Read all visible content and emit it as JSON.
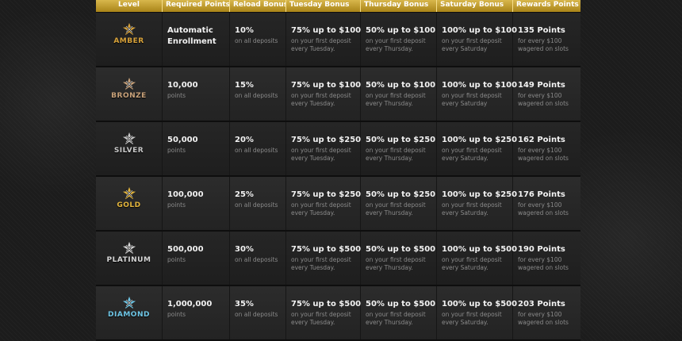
{
  "headers": [
    "Level",
    "Required Points",
    "Reload Bonus",
    "Tuesday Bonus",
    "Thursday Bonus",
    "Saturday Bonus",
    "Rewards Points"
  ],
  "rows": [
    {
      "level": "AMBER",
      "level_color": "#d9a33a",
      "required": "Automatic Enrollment",
      "required_sub": "",
      "reload": "10%",
      "reload_sub": "on all deposits",
      "tuesday": "75% up to $100",
      "tuesday_sub1": "on your first deposit",
      "tuesday_sub2": "every Tuesday.",
      "thursday": "50% up to $100",
      "thursday_sub1": "on your first deposit",
      "thursday_sub2": "every Thursday.",
      "saturday": "100% up to $100",
      "saturday_sub1": "on your first deposit",
      "saturday_sub2": "every Saturday",
      "rewards": "135 Points",
      "rewards_sub1": "for every $100",
      "rewards_sub2": "wagered on slots"
    },
    {
      "level": "BRONZE",
      "level_color": "#c9a27a",
      "required": "10,000",
      "required_sub": "points",
      "reload": "15%",
      "reload_sub": "on all deposits",
      "tuesday": "75% up to $100",
      "tuesday_sub1": "on your first deposit",
      "tuesday_sub2": "every Tuesday.",
      "thursday": "50% up to $100",
      "thursday_sub1": "on your first deposit",
      "thursday_sub2": "every Thursday.",
      "saturday": "100% up to $100",
      "saturday_sub1": "on your first deposit",
      "saturday_sub2": "every Saturday",
      "rewards": "149 Points",
      "rewards_sub1": "for every $100",
      "rewards_sub2": "wagered on slots"
    },
    {
      "level": "SILVER",
      "level_color": "#c8c8c8",
      "required": "50,000",
      "required_sub": "points",
      "reload": "20%",
      "reload_sub": "on all deposits",
      "tuesday": "75% up to $250",
      "tuesday_sub1": "on your first deposit",
      "tuesday_sub2": "every Tuesday.",
      "thursday": "50% up to $250",
      "thursday_sub1": "on your first deposit",
      "thursday_sub2": "every Thursday.",
      "saturday": "100% up to $250",
      "saturday_sub1": "on your first deposit",
      "saturday_sub2": "every Saturday.",
      "rewards": "162 Points",
      "rewards_sub1": "for every $100",
      "rewards_sub2": "wagered on slots"
    },
    {
      "level": "GOLD",
      "level_color": "#e2b43c",
      "required": "100,000",
      "required_sub": "points",
      "reload": "25%",
      "reload_sub": "on all deposits",
      "tuesday": "75% up to $250",
      "tuesday_sub1": "on your first deposit",
      "tuesday_sub2": "every Tuesday.",
      "thursday": "50% up to $250",
      "thursday_sub1": "on your first deposit",
      "thursday_sub2": "every Thursday.",
      "saturday": "100% up to $250",
      "saturday_sub1": "on your first deposit",
      "saturday_sub2": "every Saturday.",
      "rewards": "176 Points",
      "rewards_sub1": "for every $100",
      "rewards_sub2": "wagered on slots"
    },
    {
      "level": "PLATINUM",
      "level_color": "#d6d6d6",
      "required": "500,000",
      "required_sub": "points",
      "reload": "30%",
      "reload_sub": "on all deposits",
      "tuesday": "75% up to $500",
      "tuesday_sub1": "on your first deposit",
      "tuesday_sub2": "every Tuesday.",
      "thursday": "50% up to $500",
      "thursday_sub1": "on your first deposit",
      "thursday_sub2": "every Thursday.",
      "saturday": "100% up to $500",
      "saturday_sub1": "on your first deposit",
      "saturday_sub2": "every Saturday.",
      "rewards": "190 Points",
      "rewards_sub1": "for every $100",
      "rewards_sub2": "wagered on slots"
    },
    {
      "level": "DIAMOND",
      "level_color": "#6ec6e6",
      "required": "1,000,000",
      "required_sub": "points",
      "reload": "35%",
      "reload_sub": "on all deposits",
      "tuesday": "75% up to $500",
      "tuesday_sub1": "on your first deposit",
      "tuesday_sub2": "every Tuesday.",
      "thursday": "50% up to $500",
      "thursday_sub1": "on your first deposit",
      "thursday_sub2": "every Thursday.",
      "saturday": "100% up to $500",
      "saturday_sub1": "on your first deposit",
      "saturday_sub2": "every Saturday.",
      "rewards": "203 Points",
      "rewards_sub1": "for every $100",
      "rewards_sub2": "wagered on slots"
    }
  ],
  "icons": {
    "level_emblem": "x-star-emblem-icon"
  },
  "colors": {
    "header_gold": "#c9a22e",
    "panel": "#0e0e0e"
  }
}
